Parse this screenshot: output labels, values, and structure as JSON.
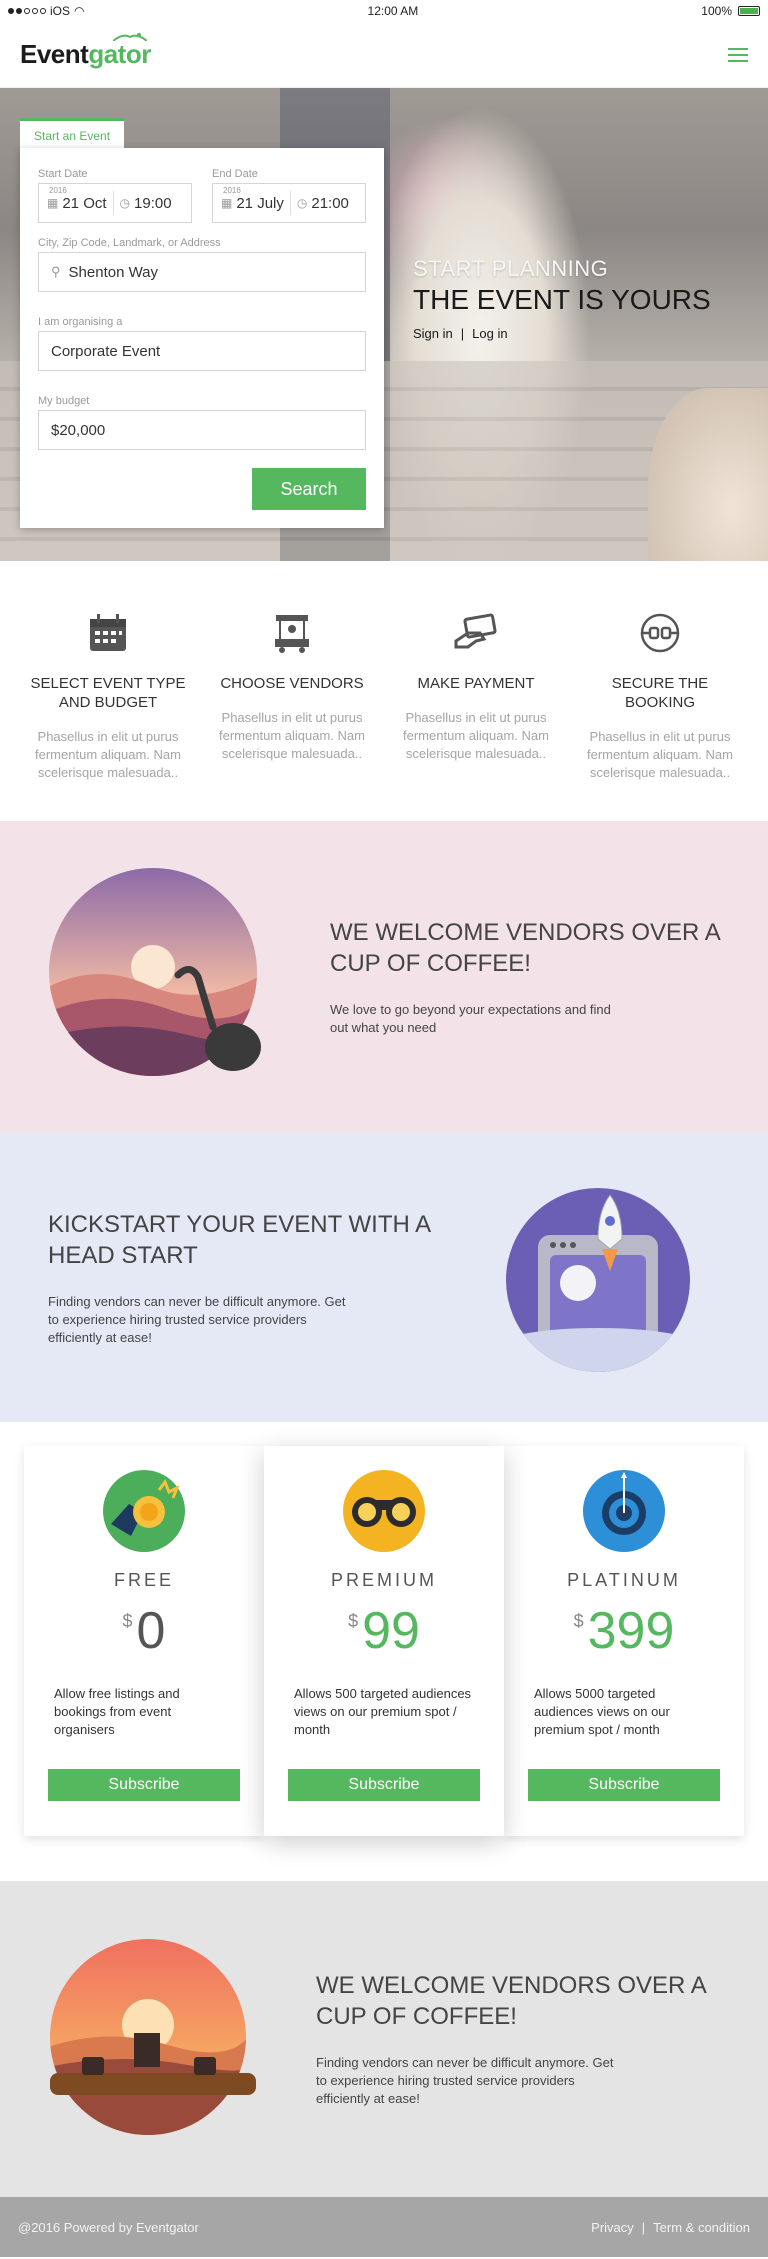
{
  "status_bar": {
    "carrier": "iOS",
    "time": "12:00 AM",
    "battery": "100%"
  },
  "header": {
    "logo_main": "Event",
    "logo_accent": "gator"
  },
  "hero": {
    "tab_label": "Start an Event",
    "start_date_label": "Start Date",
    "start_year": "2016",
    "start_date": "21 Oct",
    "start_time": "19:00",
    "end_date_label": "End Date",
    "end_year": "2016",
    "end_date": "21 July",
    "end_time": "21:00",
    "location_label": "City, Zip Code, Landmark, or Address",
    "location_value": "Shenton Way",
    "organising_label": "I am organising a",
    "organising_value": "Corporate Event",
    "budget_label": "My budget",
    "budget_value": "$20,000",
    "search_label": "Search",
    "headline_1": "START PLANNING",
    "headline_2": "THE EVENT IS YOURS",
    "sign_in": "Sign in",
    "divider": "|",
    "log_in": "Log in"
  },
  "steps": [
    {
      "title": "SELECT EVENT TYPE AND BUDGET",
      "icon": "calendar-icon",
      "text": "Phasellus in elit ut purus fermentum aliquam. Nam scelerisque malesuada.."
    },
    {
      "title": "CHOOSE VENDORS",
      "icon": "vendor-cart-icon",
      "text": "Phasellus in elit ut purus fermentum aliquam. Nam scelerisque malesuada.."
    },
    {
      "title": "MAKE PAYMENT",
      "icon": "card-payment-icon",
      "text": "Phasellus in elit ut purus fermentum aliquam. Nam scelerisque malesuada.."
    },
    {
      "title": "SECURE THE BOOKING",
      "icon": "plug-secure-icon",
      "text": "Phasellus in elit ut purus fermentum aliquam. Nam scelerisque malesuada.."
    }
  ],
  "feature_1": {
    "title": "WE WELCOME VENDORS OVER A CUP OF COFFEE!",
    "text": "We love to go beyond your expectations and find out what you need"
  },
  "feature_2": {
    "title": "KICKSTART YOUR EVENT WITH A HEAD START",
    "text": "Finding vendors can never be difficult anymore. Get to experience hiring trusted service providers efficiently at ease!"
  },
  "plans": [
    {
      "name": "FREE",
      "currency": "$",
      "price": "0",
      "desc": "Allow free listings and bookings from event organisers",
      "button": "Subscribe",
      "icon": "coin-hand-icon"
    },
    {
      "name": "PREMIUM",
      "currency": "$",
      "price": "99",
      "desc": "Allows 500 targeted audiences views on our premium spot / month",
      "button": "Subscribe",
      "icon": "binoculars-icon"
    },
    {
      "name": "PLATINUM",
      "currency": "$",
      "price": "399",
      "desc": "Allows 5000 targeted audiences views on our premium spot / month",
      "button": "Subscribe",
      "icon": "target-icon"
    }
  ],
  "feature_3": {
    "title": "WE WELCOME VENDORS OVER A CUP OF COFFEE!",
    "text": "Finding vendors can never be difficult anymore. Get to experience hiring trusted service providers efficiently at ease!"
  },
  "footer": {
    "copyright": "@2016 Powered by Eventgator",
    "privacy": "Privacy",
    "separator": "|",
    "terms": "Term & condition"
  },
  "colors": {
    "accent": "#55b85f",
    "pink_bg": "#f3e3e9",
    "blue_bg": "#e4e9f5",
    "grey_bg": "#e4e4e4",
    "footer_bg": "#a6a6a6"
  }
}
